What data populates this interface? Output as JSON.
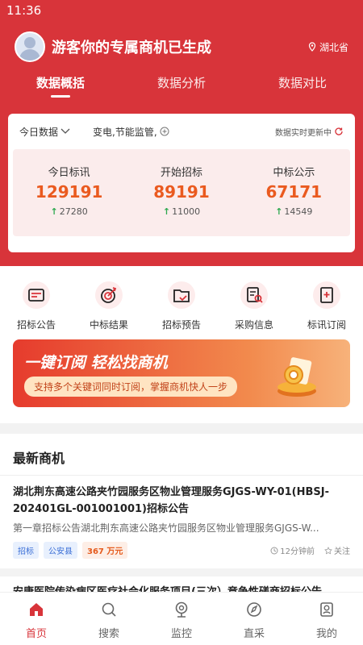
{
  "status_bar": {
    "time": "11:36"
  },
  "header": {
    "title": "游客你的专属商机已生成",
    "location": "湖北省",
    "tabs": [
      {
        "label": "数据概括",
        "active": true
      },
      {
        "label": "数据分析",
        "active": false
      },
      {
        "label": "数据对比",
        "active": false
      }
    ]
  },
  "stats_card": {
    "filter": {
      "period": "今日数据",
      "keywords": "变电,节能监管,",
      "realtime": "数据实时更新中"
    },
    "stats": [
      {
        "label": "今日标讯",
        "value": "129191",
        "delta": "27280"
      },
      {
        "label": "开始招标",
        "value": "89191",
        "delta": "11000"
      },
      {
        "label": "中标公示",
        "value": "67171",
        "delta": "14549"
      }
    ]
  },
  "menu": {
    "items": [
      {
        "label": "招标公告",
        "icon": "announcement-icon"
      },
      {
        "label": "中标结果",
        "icon": "target-icon"
      },
      {
        "label": "招标预告",
        "icon": "folder-icon"
      },
      {
        "label": "采购信息",
        "icon": "document-search-icon"
      },
      {
        "label": "标讯订阅",
        "icon": "subscribe-icon"
      }
    ]
  },
  "banner": {
    "title": "一键订阅 轻松找商机",
    "subtitle": "支持多个关键词同时订阅，掌握商机快人一步"
  },
  "latest": {
    "title": "最新商机",
    "items": [
      {
        "title": "湖北荆东高速公路夹竹园服务区物业管理服务GJGS-WY-01(HBSJ-202401GL-001001001)招标公告",
        "desc": "第一章招标公告湖北荆东高速公路夹竹园服务区物业管理服务GJGS-W...",
        "tags": [
          "招标",
          "公安县"
        ],
        "amount": "367 万元",
        "time": "12分钟前",
        "follow": "关注"
      },
      {
        "title": "安康医院传染病区医疗社会化服务项目(三次）竞争性磋商招标公告"
      }
    ]
  },
  "bottom_nav": {
    "items": [
      {
        "label": "首页",
        "active": true
      },
      {
        "label": "搜索",
        "active": false
      },
      {
        "label": "监控",
        "active": false
      },
      {
        "label": "直采",
        "active": false
      },
      {
        "label": "我的",
        "active": false
      }
    ]
  },
  "colors": {
    "brand_red": "#d8343a",
    "value_orange": "#ea5a1f",
    "tag_blue": "#3b6fd6"
  }
}
